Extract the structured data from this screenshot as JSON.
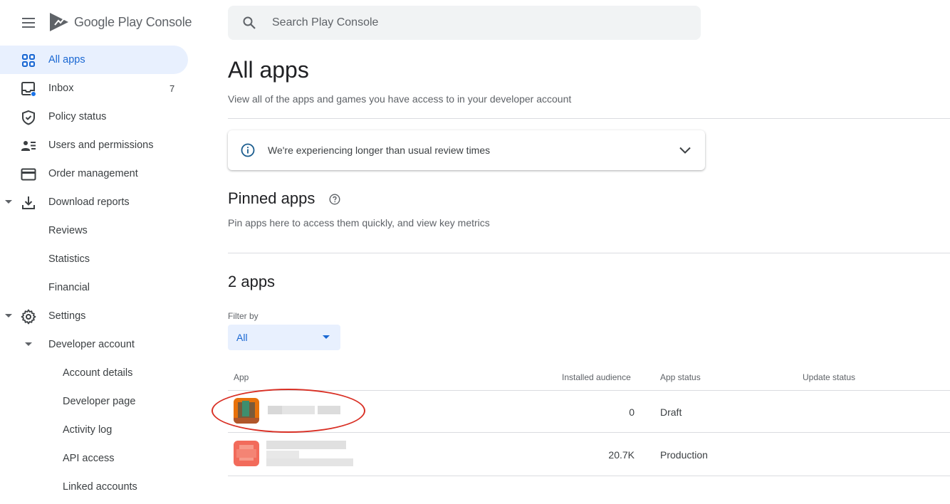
{
  "app": {
    "name_primary": "Google Play",
    "name_secondary": "Console"
  },
  "search": {
    "placeholder": "Search Play Console"
  },
  "nav": {
    "items": [
      {
        "label": "All apps",
        "icon": "grid-icon",
        "active": true
      },
      {
        "label": "Inbox",
        "icon": "inbox-icon",
        "count": "7"
      },
      {
        "label": "Policy status",
        "icon": "shield-icon"
      },
      {
        "label": "Users and permissions",
        "icon": "users-icon"
      },
      {
        "label": "Order management",
        "icon": "credit-card-icon"
      },
      {
        "label": "Download reports",
        "icon": "download-icon",
        "expanded": true
      },
      {
        "label": "Reviews"
      },
      {
        "label": "Statistics"
      },
      {
        "label": "Financial"
      },
      {
        "label": "Settings",
        "icon": "gear-icon",
        "expanded": true
      },
      {
        "label": "Developer account",
        "expanded": true
      },
      {
        "label": "Account details"
      },
      {
        "label": "Developer page"
      },
      {
        "label": "Activity log"
      },
      {
        "label": "API access"
      },
      {
        "label": "Linked accounts"
      }
    ]
  },
  "main": {
    "title": "All apps",
    "subtitle": "View all of the apps and games you have access to in your developer account",
    "banner": {
      "text": "We're experiencing longer than usual review times"
    },
    "pinned": {
      "title": "Pinned apps",
      "description": "Pin apps here to access them quickly, and view key metrics"
    },
    "apps_count": "2 apps",
    "filter": {
      "label": "Filter by",
      "value": "All"
    },
    "table": {
      "headers": [
        "App",
        "Installed audience",
        "App status",
        "Update status"
      ],
      "rows": [
        {
          "audience": "0",
          "status": "Draft"
        },
        {
          "audience": "20.7K",
          "status": "Production"
        }
      ]
    }
  },
  "colors": {
    "accent": "#1967d2",
    "active_bg": "#e8f0fe",
    "annotation": "#d93025"
  }
}
